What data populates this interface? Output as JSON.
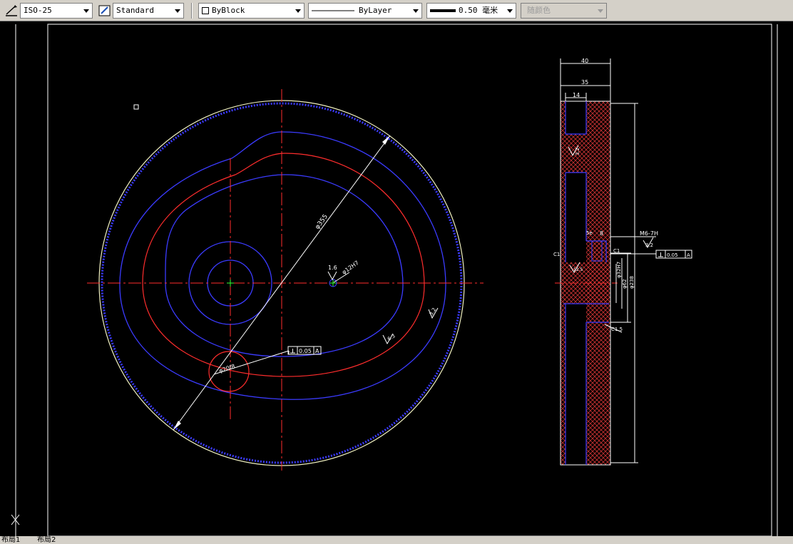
{
  "toolbar": {
    "dimstyle": "ISO-25",
    "textstyle": "Standard",
    "color": "ByBlock",
    "linetype": "ByLayer",
    "lineweight": "0.50 毫米",
    "plotstyle": "随颜色"
  },
  "drawing": {
    "diameter_outer": "φ355",
    "bore": "φ12H7",
    "roughness_bore": "1.6",
    "roller_dia": "φ20f8",
    "perp_tol_left": "0.05",
    "datum_left": "A",
    "roughness_right": "6.3",
    "roughness_slot": "3.2",
    "dim_40": "40",
    "dim_35": "35",
    "dim_14": "14",
    "dim_8": "8",
    "thread": "M6-7H",
    "roughness_hole": "3.2",
    "perp_tol_right": "0.05",
    "datum_right": "A",
    "chamfer_c1a": "C1",
    "chamfer_c1b": "C1",
    "chamfer_c15": "C1.5",
    "roughness_hub": "12.5",
    "hub_d1": "φ32H7",
    "hub_d2": "φ62",
    "hub_d3": "φ238",
    "slot_label": "5e"
  },
  "layout_tabs": [
    "布局1",
    "布局2"
  ]
}
